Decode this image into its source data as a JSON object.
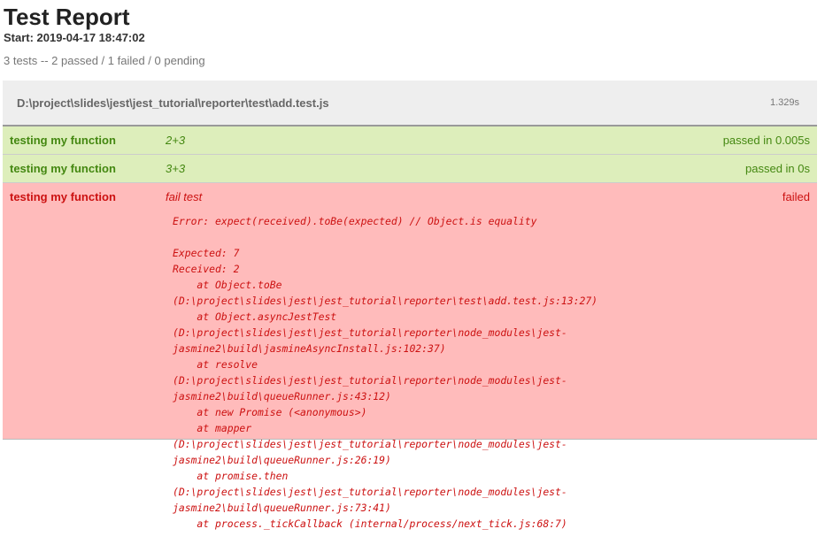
{
  "report": {
    "title": "Test Report",
    "start": "Start: 2019-04-17 18:47:02",
    "summary": "3 tests -- 2 passed / 1 failed / 0 pending"
  },
  "suite": {
    "path": "D:\\project\\slides\\jest\\jest_tutorial\\reporter\\test\\add.test.js",
    "duration": "1.329s"
  },
  "tests": [
    {
      "suite_name": "testing my function",
      "title": "2+3",
      "status_text": "passed in 0.005s",
      "status": "passed"
    },
    {
      "suite_name": "testing my function",
      "title": "3+3",
      "status_text": "passed in 0s",
      "status": "passed"
    },
    {
      "suite_name": "testing my function",
      "title": "fail test",
      "status_text": "failed",
      "status": "failed",
      "error": "Error: expect(received).toBe(expected) // Object.is equality\n\nExpected: 7\nReceived: 2\n    at Object.toBe\n(D:\\project\\slides\\jest\\jest_tutorial\\reporter\\test\\add.test.js:13:27)\n    at Object.asyncJestTest\n(D:\\project\\slides\\jest\\jest_tutorial\\reporter\\node_modules\\jest-\njasmine2\\build\\jasmineAsyncInstall.js:102:37)\n    at resolve\n(D:\\project\\slides\\jest\\jest_tutorial\\reporter\\node_modules\\jest-\njasmine2\\build\\queueRunner.js:43:12)\n    at new Promise (<anonymous>)\n    at mapper\n(D:\\project\\slides\\jest\\jest_tutorial\\reporter\\node_modules\\jest-\njasmine2\\build\\queueRunner.js:26:19)\n    at promise.then\n(D:\\project\\slides\\jest\\jest_tutorial\\reporter\\node_modules\\jest-\njasmine2\\build\\queueRunner.js:73:41)\n    at process._tickCallback (internal/process/next_tick.js:68:7)"
    }
  ],
  "colors": {
    "passed_bg": "#ddeebb",
    "passed_text": "#448811",
    "failed_bg": "#ffbbbb",
    "failed_text": "#cc1111",
    "suite_header_bg": "#eeeeee"
  }
}
